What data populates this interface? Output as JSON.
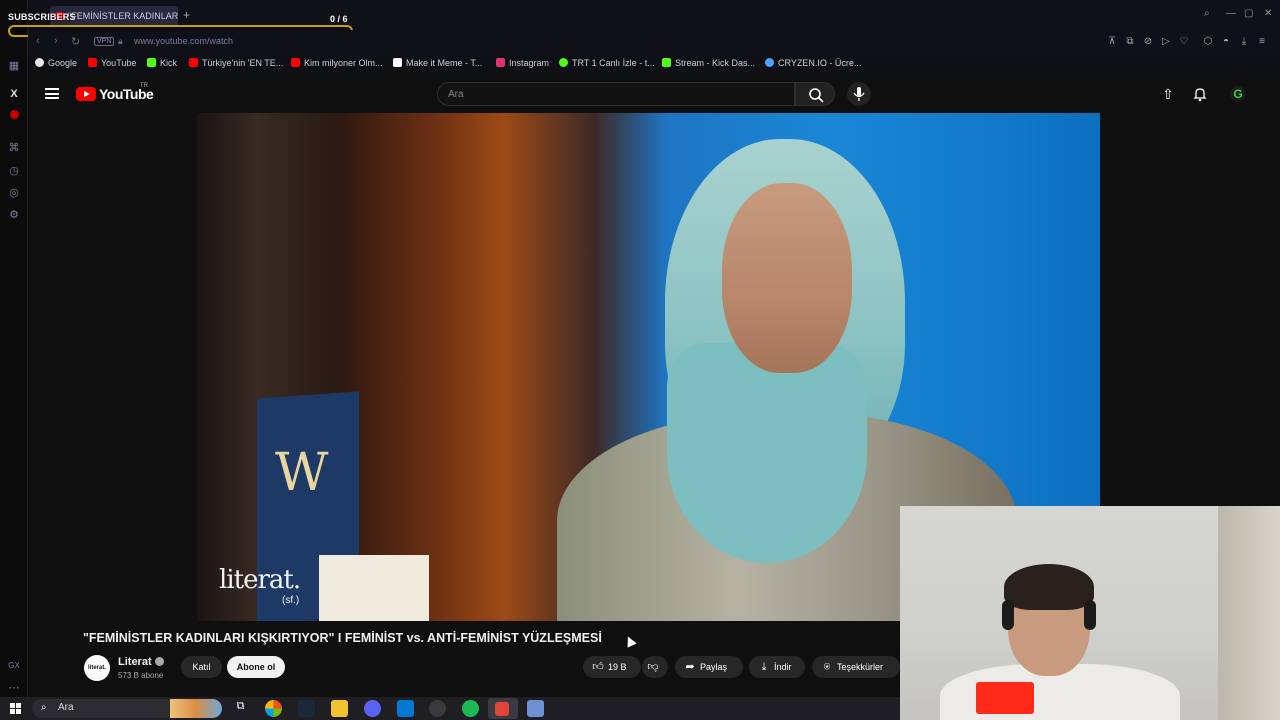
{
  "browser": {
    "tab_title": "\"FEMİNİSTLER KADINLARI",
    "url": "www.youtube.com/watch",
    "vpn_label": "VPN",
    "bookmarks": [
      {
        "label": "Google",
        "color": "#e8e8e8"
      },
      {
        "label": "YouTube",
        "color": "#ff0000"
      },
      {
        "label": "Kick",
        "color": "#53fc18"
      },
      {
        "label": "Türkiye'nin 'EN TE...",
        "color": "#ff0000"
      },
      {
        "label": "Kim milyoner Olm...",
        "color": "#ff0000"
      },
      {
        "label": "Make it Meme - T...",
        "color": "#ffffff"
      },
      {
        "label": "Instagram",
        "color": "#e1306c"
      },
      {
        "label": "TRT 1 Canlı İzle - t...",
        "color": "#53fc18"
      },
      {
        "label": "Stream - Kick Das...",
        "color": "#53fc18"
      },
      {
        "label": "CRYZEN.IO - Ücre...",
        "color": "#4aa3ff"
      }
    ]
  },
  "overlay": {
    "subscribers_label": "SUBSCRIBERS",
    "subscribers_count": "0 / 6",
    "goal_bar_color": "#c9a400"
  },
  "youtube": {
    "logo_text": "YouTube",
    "country_code": "TR",
    "search_placeholder": "Ara",
    "video": {
      "watermark": "literat.",
      "watermark_sub": "(sf.)",
      "title": "\"FEMİNİSTLER KADINLARI KIŞKIRTIYOR\" I FEMİNİST vs. ANTİ-FEMİNİST YÜZLEŞMESİ"
    },
    "channel": {
      "avatar_text": "literat.",
      "name": "Literat",
      "subscribers": "573 B abone"
    },
    "buttons": {
      "join": "Katıl",
      "subscribe": "Abone ol",
      "likes": "19 B",
      "share": "Paylaş",
      "download": "İndir",
      "thanks": "Teşekkürler"
    }
  },
  "taskbar": {
    "search_placeholder": "Ara"
  },
  "icons": {
    "left_rail": [
      "opera-icon",
      "twitter-x-icon",
      "youtube-music-icon",
      "pinboard-icon",
      "history-icon",
      "messenger-icon",
      "settings-icon",
      "more-icon"
    ],
    "masthead": [
      "upload-icon",
      "bell-icon",
      "grammarly-icon"
    ]
  }
}
